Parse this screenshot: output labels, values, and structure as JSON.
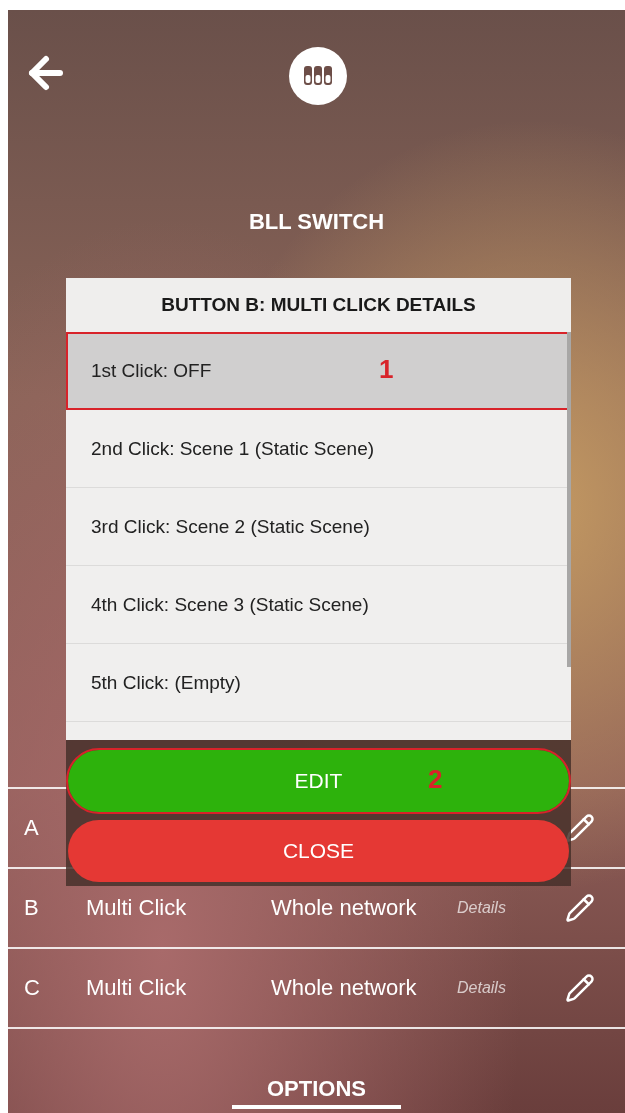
{
  "header": {
    "title": "BLL SWITCH"
  },
  "table": {
    "rows": [
      {
        "letter": "A"
      },
      {
        "letter": "B",
        "function": "Multi Click",
        "destination": "Whole network",
        "details": "Details"
      },
      {
        "letter": "C",
        "function": "Multi Click",
        "destination": "Whole network",
        "details": "Details"
      }
    ]
  },
  "options": {
    "label": "OPTIONS"
  },
  "modal": {
    "title": "BUTTON B: MULTI CLICK DETAILS",
    "items": [
      {
        "label": "1st Click: OFF",
        "selected": true,
        "annotation": "1"
      },
      {
        "label": "2nd Click: Scene 1 (Static Scene)",
        "selected": false
      },
      {
        "label": "3rd Click: Scene 2 (Static Scene)",
        "selected": false
      },
      {
        "label": "4th Click: Scene 3 (Static Scene)",
        "selected": false
      },
      {
        "label": "5th Click: (Empty)",
        "selected": false
      }
    ],
    "buttons": [
      {
        "label": "EDIT",
        "kind": "edit",
        "annotation": "2"
      },
      {
        "label": "CLOSE",
        "kind": "close"
      }
    ]
  }
}
